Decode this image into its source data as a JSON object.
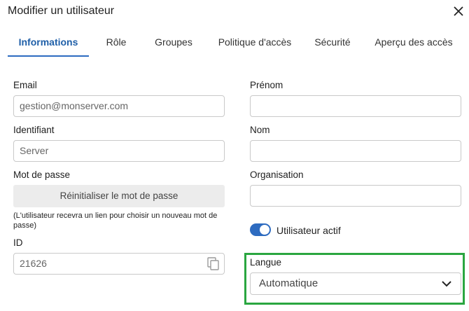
{
  "dialog": {
    "title": "Modifier un utilisateur",
    "close_icon": "close-icon"
  },
  "tabs": [
    {
      "label": "Informations",
      "active": true
    },
    {
      "label": "Rôle"
    },
    {
      "label": "Groupes"
    },
    {
      "label": "Politique d'accès"
    },
    {
      "label": "Sécurité"
    },
    {
      "label": "Aperçu des accès"
    }
  ],
  "form": {
    "email": {
      "label": "Email",
      "value": "gestion@monserver.com"
    },
    "identifiant": {
      "label": "Identifiant",
      "value": "Server"
    },
    "password": {
      "label": "Mot de passe",
      "reset_button": "Réinitialiser le mot de passe",
      "note": "(L'utilisateur recevra un lien pour choisir un nouveau mot de passe)"
    },
    "id": {
      "label": "ID",
      "value": "21626",
      "icon": "copy-icon"
    },
    "prenom": {
      "label": "Prénom",
      "value": ""
    },
    "nom": {
      "label": "Nom",
      "value": ""
    },
    "organisation": {
      "label": "Organisation",
      "value": ""
    },
    "active_toggle": {
      "label": "Utilisateur actif",
      "checked": true
    },
    "langue": {
      "label": "Langue",
      "selected": "Automatique"
    }
  },
  "colors": {
    "accent": "#2d6bc0",
    "highlight": "#2aa640"
  }
}
